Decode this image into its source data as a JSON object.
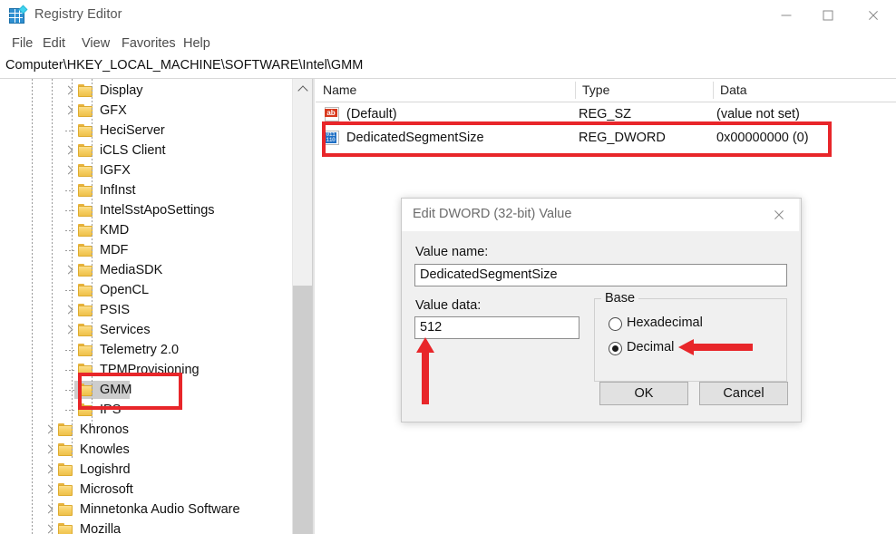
{
  "window": {
    "title": "Registry Editor",
    "icon": "registry-editor-icon",
    "controls": {
      "minimize": "minimize-icon",
      "maximize": "maximize-icon",
      "close": "close-icon"
    }
  },
  "menubar": {
    "items": [
      "File",
      "Edit",
      "View",
      "Favorites",
      "Help"
    ]
  },
  "address": {
    "path": "Computer\\HKEY_LOCAL_MACHINE\\SOFTWARE\\Intel\\GMM"
  },
  "tree": {
    "items": [
      {
        "label": "Display",
        "indent": 3,
        "expandable": true,
        "selected": false
      },
      {
        "label": "GFX",
        "indent": 3,
        "expandable": true,
        "selected": false
      },
      {
        "label": "HeciServer",
        "indent": 3,
        "expandable": false,
        "selected": false
      },
      {
        "label": "iCLS Client",
        "indent": 3,
        "expandable": true,
        "selected": false
      },
      {
        "label": "IGFX",
        "indent": 3,
        "expandable": true,
        "selected": false
      },
      {
        "label": "InfInst",
        "indent": 3,
        "expandable": false,
        "selected": false
      },
      {
        "label": "IntelSstApoSettings",
        "indent": 3,
        "expandable": false,
        "selected": false
      },
      {
        "label": "KMD",
        "indent": 3,
        "expandable": false,
        "selected": false
      },
      {
        "label": "MDF",
        "indent": 3,
        "expandable": false,
        "selected": false
      },
      {
        "label": "MediaSDK",
        "indent": 3,
        "expandable": true,
        "selected": false
      },
      {
        "label": "OpenCL",
        "indent": 3,
        "expandable": false,
        "selected": false
      },
      {
        "label": "PSIS",
        "indent": 3,
        "expandable": true,
        "selected": false
      },
      {
        "label": "Services",
        "indent": 3,
        "expandable": true,
        "selected": false
      },
      {
        "label": "Telemetry 2.0",
        "indent": 3,
        "expandable": false,
        "selected": false
      },
      {
        "label": "TPMProvisioning",
        "indent": 3,
        "expandable": false,
        "selected": false
      },
      {
        "label": "GMM",
        "indent": 3,
        "expandable": false,
        "selected": true
      },
      {
        "label": "IPS",
        "indent": 3,
        "expandable": false,
        "selected": false
      },
      {
        "label": "Khronos",
        "indent": 2,
        "expandable": true,
        "selected": false
      },
      {
        "label": "Knowles",
        "indent": 2,
        "expandable": true,
        "selected": false
      },
      {
        "label": "Logishrd",
        "indent": 2,
        "expandable": true,
        "selected": false
      },
      {
        "label": "Microsoft",
        "indent": 2,
        "expandable": true,
        "selected": false
      },
      {
        "label": "Minnetonka Audio Software",
        "indent": 2,
        "expandable": true,
        "selected": false
      },
      {
        "label": "Mozilla",
        "indent": 2,
        "expandable": true,
        "selected": false
      }
    ],
    "scroll_up_icon": "chevron-up-icon"
  },
  "list": {
    "columns": [
      "Name",
      "Type",
      "Data"
    ],
    "rows": [
      {
        "icon": "string-value-icon",
        "icon_text": "ab",
        "name": "(Default)",
        "type": "REG_SZ",
        "data": "(value not set)"
      },
      {
        "icon": "dword-value-icon",
        "icon_text": "011",
        "name": "DedicatedSegmentSize",
        "type": "REG_DWORD",
        "data": "0x00000000 (0)"
      }
    ]
  },
  "dialog": {
    "title": "Edit DWORD (32-bit) Value",
    "close_icon": "close-icon",
    "value_name_label": "Value name:",
    "value_name": "DedicatedSegmentSize",
    "value_data_label": "Value data:",
    "value_data": "512",
    "base_group_label": "Base",
    "base_options": [
      {
        "label": "Hexadecimal",
        "selected": false
      },
      {
        "label": "Decimal",
        "selected": true
      }
    ],
    "ok_label": "OK",
    "cancel_label": "Cancel"
  },
  "annotations": {
    "accent_color": "#e8262a",
    "box_list_row": "highlights DedicatedSegmentSize row",
    "box_tree_gmm": "highlights GMM key",
    "arrow_value_data": "points up at Value data field",
    "arrow_decimal": "points left at Decimal radio"
  }
}
